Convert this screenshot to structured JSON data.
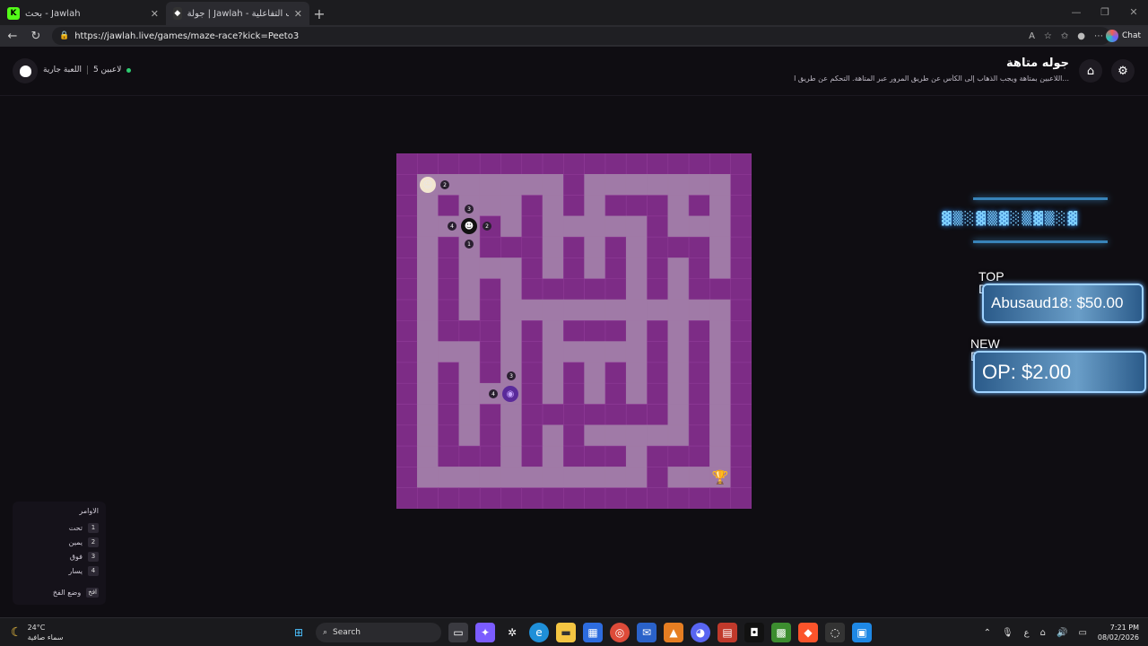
{
  "browser": {
    "tabs": [
      {
        "label": "بحث - Jawlah",
        "icon": "kick-icon"
      },
      {
        "label": "جولة | Jawlah - منصة الألعاب التفاعلية",
        "icon": "jawlah-icon"
      }
    ],
    "url": "https://jawlah.live/games/maze-race?kick=Peeto3",
    "chat_label": "Chat"
  },
  "header": {
    "title": "جوله متاهة",
    "description": "اللاعبين بمتاهة ويجب الذهاب إلى الكأس عن طريق المرور عبر المتاهة. التحكم عن طريق ا...",
    "status_players": "5 لاعبين",
    "status_game": "اللعبة جارية"
  },
  "maze": {
    "tokens": [
      {
        "id": "player-a",
        "badges": [
          "2"
        ]
      },
      {
        "id": "player-b",
        "badges": [
          "3",
          "4",
          "2",
          "1"
        ]
      },
      {
        "id": "player-c",
        "badges": [
          "3",
          "4"
        ]
      }
    ],
    "goal": "trophy-icon"
  },
  "overlay": {
    "top_donation_label": "TOP\nDONATION",
    "top_donation_value": "Abusaud18: $50.00",
    "new_donation_label": "NEW\nDONATION",
    "new_donation_value": "OP: $2.00"
  },
  "commands": {
    "title": "الاوامر",
    "items": [
      {
        "key": "1",
        "label": "تحت"
      },
      {
        "key": "2",
        "label": "يمين"
      },
      {
        "key": "3",
        "label": "فوق"
      },
      {
        "key": "4",
        "label": "يسار"
      }
    ],
    "trap_key": "افخ",
    "trap_label": "وضع الفخ"
  },
  "taskbar": {
    "temperature": "24°C",
    "weather": "سماء صافية",
    "search": "Search",
    "time": "7:21 PM",
    "date": "08/02/2026",
    "lang": "ع"
  }
}
